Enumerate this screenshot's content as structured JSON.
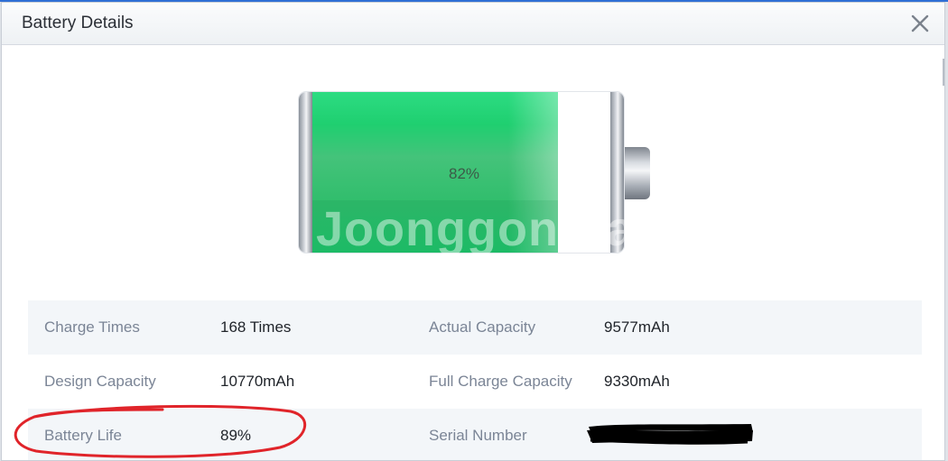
{
  "window": {
    "title": "Battery Details",
    "accent_color": "#2f6fd6",
    "close_icon": "close-icon"
  },
  "battery": {
    "charge_percent_label": "82%",
    "charge_fraction": 0.82,
    "fill_color": "#2fd07a",
    "watermark": "Joonggonara"
  },
  "details": {
    "rows": [
      {
        "left_label": "Charge Times",
        "left_value": "168 Times",
        "right_label": "Actual Capacity",
        "right_value": "9577mAh"
      },
      {
        "left_label": "Design Capacity",
        "left_value": "10770mAh",
        "right_label": "Full Charge Capacity",
        "right_value": "9330mAh"
      },
      {
        "left_label": "Battery Life",
        "left_value": "89%",
        "right_label": "Serial Number",
        "right_value": ""
      }
    ]
  },
  "annotations": {
    "circle_color": "#e0242a",
    "redaction_color": "#000000"
  }
}
